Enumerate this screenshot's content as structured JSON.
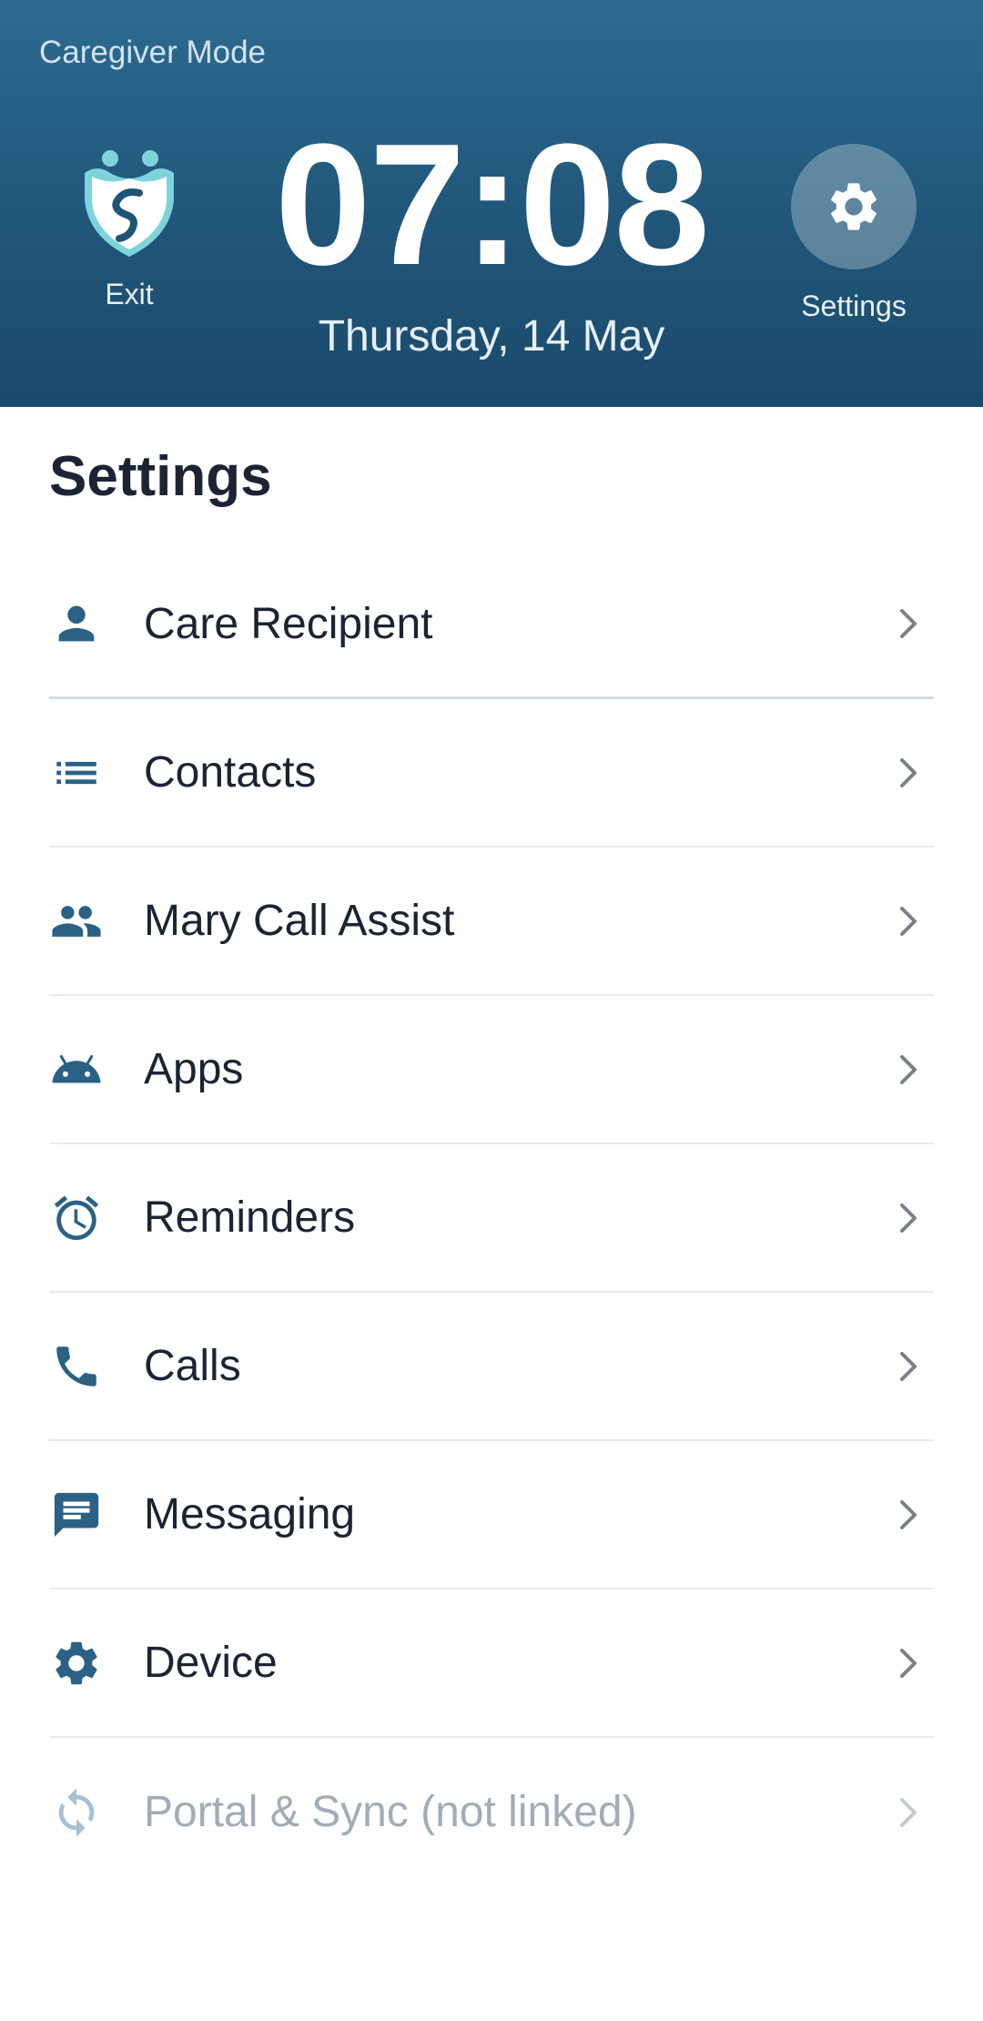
{
  "header": {
    "mode_label": "Caregiver Mode",
    "exit_label": "Exit",
    "time": "07:08",
    "date": "Thursday, 14 May",
    "settings_label": "Settings"
  },
  "page_title": "Settings",
  "items": [
    {
      "label": "Care Recipient",
      "icon": "person-icon"
    },
    {
      "label": "Contacts",
      "icon": "list-icon"
    },
    {
      "label": "Mary Call Assist",
      "icon": "people-icon"
    },
    {
      "label": "Apps",
      "icon": "android-icon"
    },
    {
      "label": "Reminders",
      "icon": "alarm-icon"
    },
    {
      "label": "Calls",
      "icon": "phone-icon"
    },
    {
      "label": "Messaging",
      "icon": "message-icon"
    },
    {
      "label": "Device",
      "icon": "gear-icon"
    },
    {
      "label": "Portal & Sync (not linked)",
      "icon": "sync-icon",
      "disabled": true
    }
  ],
  "colors": {
    "header": "#20567a",
    "accent": "#2a6185",
    "text": "#1c2433",
    "disabled_text": "#a2acb6"
  }
}
